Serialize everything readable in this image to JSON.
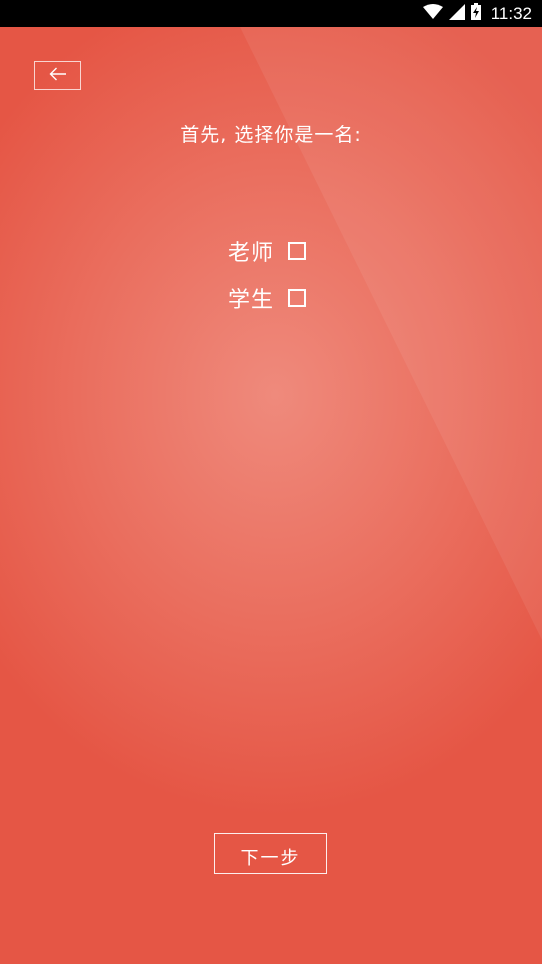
{
  "status_bar": {
    "time": "11:32",
    "icons": [
      "wifi-icon",
      "cell-signal-icon",
      "battery-charging-icon"
    ]
  },
  "header": {
    "back_icon": "arrow-left-icon"
  },
  "main": {
    "prompt": "首先, 选择你是一名:",
    "options": [
      {
        "label": "老师",
        "checked": false
      },
      {
        "label": "学生",
        "checked": false
      }
    ]
  },
  "footer": {
    "next_label": "下一步"
  },
  "colors": {
    "background": "#ea6e5e",
    "background_highlight": "#ef8a7c",
    "foreground": "#ffffff",
    "status_bar": "#000000"
  }
}
